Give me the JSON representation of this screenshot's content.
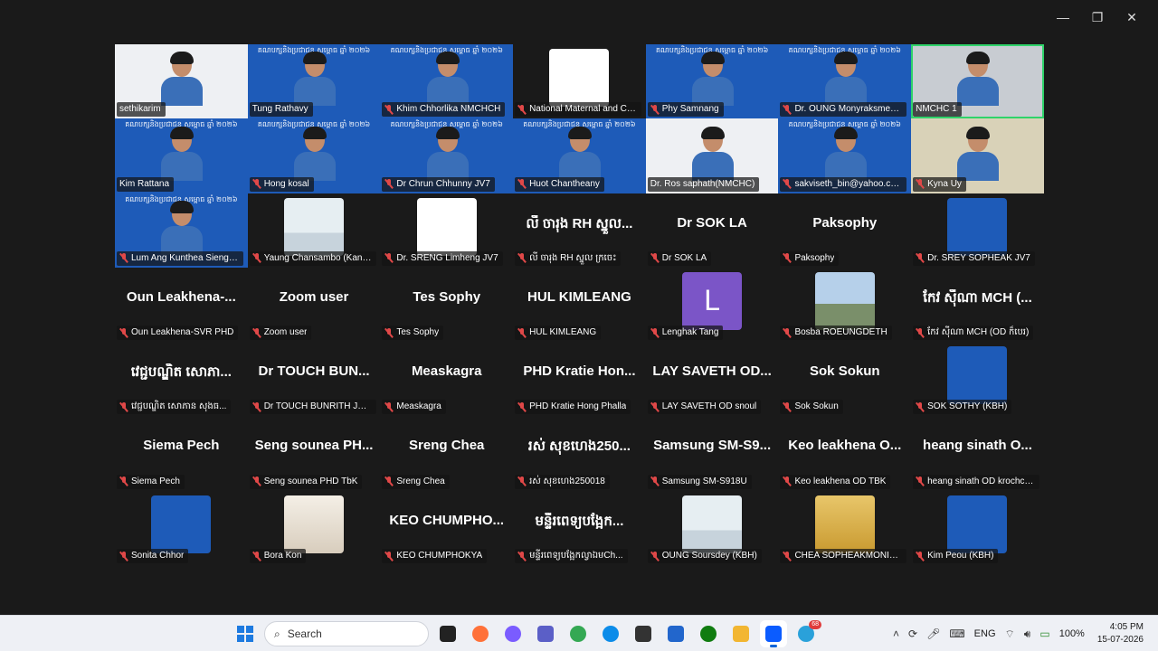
{
  "window_controls": {
    "minimize": "—",
    "maximize": "❐",
    "close": "✕"
  },
  "banner_text": "គណបក្សនិងប្រជាជន សម្ពោធ ឆ្នាំ ២០២៦",
  "tiles": [
    {
      "name": "sethikarim",
      "kind": "cam",
      "bg": "cam-white",
      "muted": false
    },
    {
      "name": "Tung Rathavy",
      "kind": "cam",
      "bg": "cam-blue",
      "muted": false
    },
    {
      "name": "Khim Chhorlika NMCHCH",
      "kind": "cam",
      "bg": "cam-blue",
      "muted": true
    },
    {
      "name": "National Maternal and Ch...",
      "kind": "avatar",
      "av": "av-logo",
      "muted": true
    },
    {
      "name": "Phy Samnang",
      "kind": "cam",
      "bg": "cam-blue",
      "muted": true
    },
    {
      "name": "Dr. OUNG Monyraksmey ...",
      "kind": "cam",
      "bg": "cam-blue",
      "muted": true
    },
    {
      "name": "NMCHC 1",
      "kind": "cam",
      "bg": "cam-room",
      "muted": false,
      "active": true
    },
    {
      "name": "Kim Rattana",
      "kind": "cam",
      "bg": "cam-blue",
      "muted": false
    },
    {
      "name": "Hong kosal",
      "kind": "cam",
      "bg": "cam-blue",
      "muted": true
    },
    {
      "name": "Dr Chrun Chhunny JV7",
      "kind": "cam",
      "bg": "cam-blue",
      "muted": true
    },
    {
      "name": "Huot Chantheany",
      "kind": "cam",
      "bg": "cam-blue",
      "muted": true
    },
    {
      "name": "Dr. Ros saphath(NMCHC)",
      "kind": "cam",
      "bg": "cam-white",
      "muted": false
    },
    {
      "name": "sakviseth_bin@yahoo.com",
      "kind": "cam",
      "bg": "cam-blue",
      "muted": true
    },
    {
      "name": "Kyna Uy",
      "kind": "cam",
      "bg": "cam-tan",
      "muted": true
    },
    {
      "name": "Lum Ang Kunthea Sieng -...",
      "kind": "cam",
      "bg": "cam-blue",
      "muted": true
    },
    {
      "name": "Yaung Chansambo (Kanth...",
      "kind": "avatar",
      "av": "av-doc",
      "muted": true
    },
    {
      "name": "Dr. SRENG Limheng JV7",
      "kind": "avatar",
      "av": "av-logo",
      "muted": true
    },
    {
      "name": "លី ចារុង RH ស្នួល ក្រចេះ",
      "kind": "text",
      "big": "លី ចារុង RH ស្នួល...",
      "muted": true
    },
    {
      "name": "Dr SOK LA",
      "kind": "text",
      "big": "Dr SOK LA",
      "muted": true
    },
    {
      "name": "Paksophy",
      "kind": "text",
      "big": "Paksophy",
      "muted": true
    },
    {
      "name": "Dr. SREY SOPHEAK JV7",
      "kind": "avatar",
      "av": "av-blue",
      "muted": true
    },
    {
      "name": "Oun Leakhena-SVR PHD",
      "kind": "text",
      "big": "Oun Leakhena-...",
      "muted": true
    },
    {
      "name": "Zoom user",
      "kind": "text",
      "big": "Zoom user",
      "muted": true
    },
    {
      "name": "Tes Sophy",
      "kind": "text",
      "big": "Tes Sophy",
      "muted": true
    },
    {
      "name": "HUL KIMLEANG",
      "kind": "text",
      "big": "HUL KIMLEANG",
      "muted": true
    },
    {
      "name": "Lenghak Tang",
      "kind": "letter",
      "letter": "L",
      "muted": true
    },
    {
      "name": "Bosba ROEUNGDETH",
      "kind": "avatar",
      "av": "av-sky",
      "muted": true
    },
    {
      "name": "កែវ ស៊ីណា MCH (OD ក៏បេរ)",
      "kind": "text",
      "big": "កែវ ស៊ីណា MCH (...",
      "muted": true
    },
    {
      "name": "វេជ្ជបណ្ឌិត សោភាន សុងធ...",
      "kind": "text",
      "big": "វេជ្ជបណ្ឌិត សោភា...",
      "muted": true
    },
    {
      "name": "Dr TOUCH BUNRITH JV 7 ...",
      "kind": "text",
      "big": "Dr TOUCH BUN...",
      "muted": true
    },
    {
      "name": "Measkagra",
      "kind": "text",
      "big": "Measkagra",
      "muted": true
    },
    {
      "name": "PHD Kratie Hong Phalla",
      "kind": "text",
      "big": "PHD Kratie Hon...",
      "muted": true
    },
    {
      "name": "LAY SAVETH OD snoul",
      "kind": "text",
      "big": "LAY SAVETH OD...",
      "muted": true
    },
    {
      "name": "Sok Sokun",
      "kind": "text",
      "big": "Sok Sokun",
      "muted": true
    },
    {
      "name": "SOK SOTHY (KBH)",
      "kind": "avatar",
      "av": "av-blue",
      "muted": true
    },
    {
      "name": "Siema Pech",
      "kind": "text",
      "big": "Siema Pech",
      "muted": true
    },
    {
      "name": "Seng sounea PHD TbK",
      "kind": "text",
      "big": "Seng sounea PH...",
      "muted": true
    },
    {
      "name": "Sreng Chea",
      "kind": "text",
      "big": "Sreng Chea",
      "muted": true
    },
    {
      "name": "រស់ សុខហេង250018",
      "kind": "text",
      "big": "រស់ សុខហេង250...",
      "muted": true
    },
    {
      "name": "Samsung SM-S918U",
      "kind": "text",
      "big": "Samsung SM-S9...",
      "muted": true
    },
    {
      "name": "Keo leakhena OD TBK",
      "kind": "text",
      "big": "Keo leakhena O...",
      "muted": true
    },
    {
      "name": "heang sinath OD krochcc...",
      "kind": "text",
      "big": "heang sinath O...",
      "muted": true
    },
    {
      "name": "Sonita Chhor",
      "kind": "avatar",
      "av": "av-blue",
      "muted": true
    },
    {
      "name": "Bora Kon",
      "kind": "avatar",
      "av": "av-photo",
      "muted": true
    },
    {
      "name": "KEO CHUMPHOKYA",
      "kind": "text",
      "big": "KEO CHUMPHO...",
      "muted": true
    },
    {
      "name": "មន្ទីរពេទ្យបង្អែកល្វាឯមCh...",
      "kind": "text",
      "big": "មន្ទីរពេទ្យបង្អែក...",
      "muted": true
    },
    {
      "name": "OUNG Soursdey (KBH)",
      "kind": "avatar",
      "av": "av-doc",
      "muted": true
    },
    {
      "name": "CHEA SOPHEAKMONIRO...",
      "kind": "avatar",
      "av": "av-gold",
      "muted": true
    },
    {
      "name": "Kim Peou (KBH)",
      "kind": "avatar",
      "av": "av-blue",
      "muted": true
    }
  ],
  "taskbar": {
    "search_placeholder": "Search",
    "apps": [
      {
        "name": "windows-start-icon",
        "color": "#1d7ae0"
      },
      {
        "name": "task-view-icon",
        "color": "#222222"
      },
      {
        "name": "firefox-icon",
        "color": "#ff7139"
      },
      {
        "name": "copilot-icon",
        "color": "#7a5cff"
      },
      {
        "name": "teams-icon",
        "color": "#5b5fc7"
      },
      {
        "name": "chrome-icon",
        "color": "#34a853"
      },
      {
        "name": "edge-icon",
        "color": "#0c8ce9"
      },
      {
        "name": "app-cube-icon",
        "color": "#333333"
      },
      {
        "name": "app-blue-icon",
        "color": "#2266cc"
      },
      {
        "name": "xbox-icon",
        "color": "#107c10"
      },
      {
        "name": "file-explorer-icon",
        "color": "#f2b632"
      },
      {
        "name": "zoom-icon",
        "color": "#0b5cff",
        "active": true
      },
      {
        "name": "telegram-icon",
        "color": "#2aa1da",
        "badge": "68"
      }
    ],
    "language": "ENG",
    "battery": "100%",
    "time": "4:05 PM",
    "date": "15-07-2026"
  }
}
